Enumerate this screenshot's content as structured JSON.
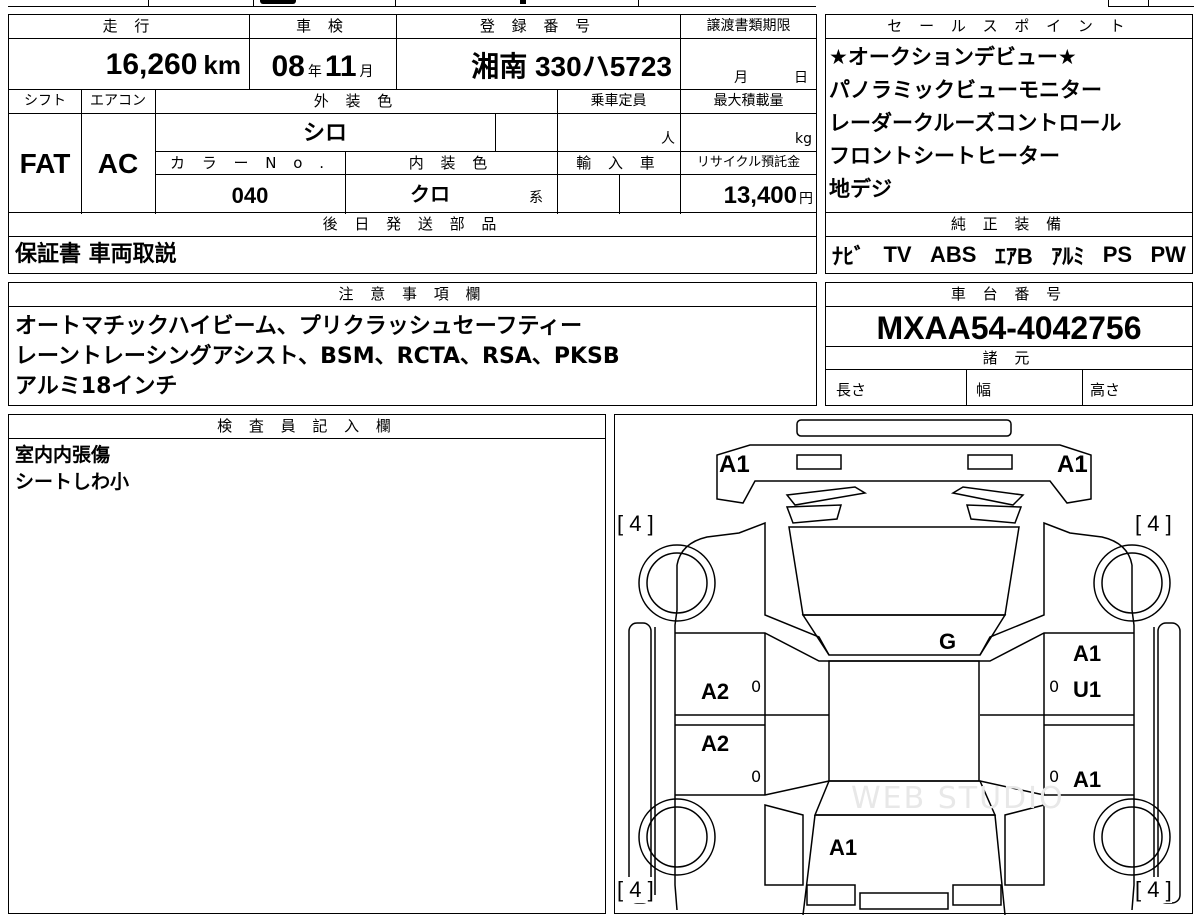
{
  "vehicle_info": {
    "mileage_label": "走 行",
    "mileage_value": "16,260",
    "mileage_unit": "km",
    "shaken_label": "車 検",
    "shaken_year": "08",
    "year_unit": "年",
    "shaken_month": "11",
    "month_unit": "月",
    "registration_label": "登 録 番 号",
    "registration_value": "湘南 330ハ5723",
    "transfer_deadline_label": "譲渡書類期限",
    "transfer_month_unit": "月",
    "transfer_day_unit": "日",
    "shift_label": "シフト",
    "shift_value": "FAT",
    "aircon_label": "エアコン",
    "aircon_value": "AC",
    "exterior_color_label": "外 装 色",
    "exterior_color_value": "シロ",
    "capacity_label": "乗車定員",
    "capacity_unit": "人",
    "max_load_label": "最大積載量",
    "max_load_unit": "kg",
    "color_no_label": "カ ラ ー N o .",
    "color_no_value": "040",
    "interior_color_label": "内 装 色",
    "interior_color_value": "クロ",
    "interior_color_suffix": "系",
    "import_label": "輸 入 車",
    "recycle_label": "リサイクル預託金",
    "recycle_value": "13,400",
    "recycle_unit": "円"
  },
  "sales_points": {
    "label": "セ ー ル ス ポ イ ン ト",
    "items": [
      "★オークションデビュー★",
      "パノラミックビューモニター",
      "レーダークルーズコントロール",
      "フロントシートヒーター",
      "地デジ"
    ]
  },
  "later_parts": {
    "label": "後 日 発 送 部 品",
    "value": "保証書 車両取説"
  },
  "genuine_equipment": {
    "label": "純 正 装 備",
    "items": [
      "ﾅﾋﾞ",
      "TV",
      "ABS",
      "ｴｱB",
      "ｱﾙﾐ",
      "PS",
      "PW"
    ]
  },
  "notes": {
    "label": "注 意 事 項 欄",
    "lines": [
      "オートマチックハイビーム、プリクラッシュセーフティー",
      "レーントレーシングアシスト、BSM、RCTA、RSA、PKSB",
      "アルミ18インチ"
    ]
  },
  "chassis": {
    "label": "車 台 番 号",
    "value": "MXAA54-4042756"
  },
  "specs": {
    "label": "諸 元",
    "length_label": "長さ",
    "width_label": "幅",
    "height_label": "高さ"
  },
  "inspector": {
    "label": "検 査 員 記 入 欄",
    "lines": [
      "室内内張傷",
      "シートしわ小"
    ]
  },
  "diagram": {
    "marks": {
      "hood_left": "A1",
      "hood_right": "A1",
      "tire_fl": "[ 4 ]",
      "tire_fr": "[ 4 ]",
      "tire_rl": "[ 4 ]",
      "tire_rr": "[ 4 ]",
      "windshield": "G",
      "right_front_door_a": "A1",
      "right_front_door_u": "U1",
      "left_front_door": "A2",
      "left_rear_door": "A2",
      "right_rear_door": "A1",
      "rear": "A1",
      "zero_lf": "0",
      "zero_lr": "0",
      "zero_rf": "0",
      "zero_rr": "0"
    },
    "watermark": "WEB STUDIO"
  }
}
